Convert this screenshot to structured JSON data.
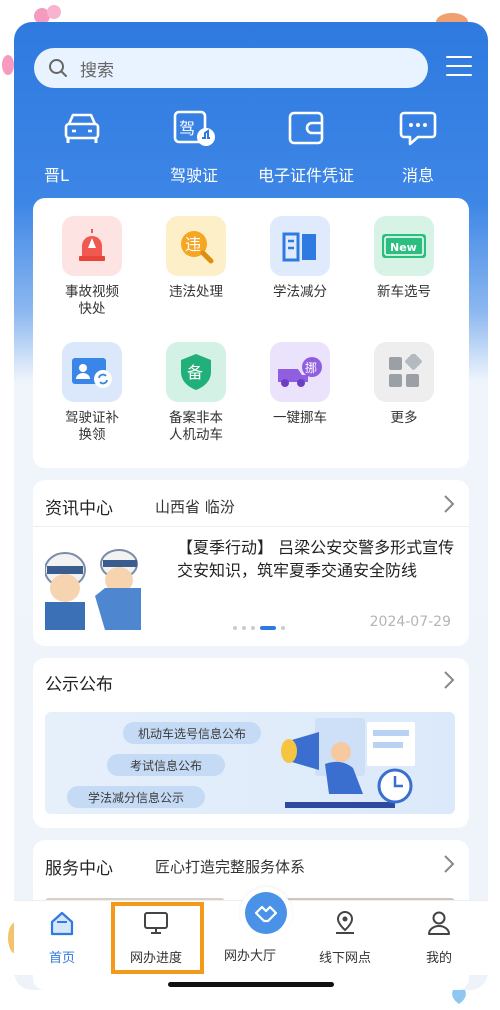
{
  "search": {
    "placeholder": "搜索"
  },
  "shortcuts": [
    {
      "label": "晋L",
      "icon": "car-icon"
    },
    {
      "label": "驾驶证",
      "icon": "license-icon"
    },
    {
      "label": "电子证件凭证",
      "icon": "wallet-icon"
    },
    {
      "label": "消息",
      "icon": "message-icon"
    }
  ],
  "services": [
    {
      "label": "事故视频快处",
      "icon": "alarm-icon",
      "color": "#f0594f"
    },
    {
      "label": "违法处理",
      "icon": "violation-search-icon",
      "color": "#f5a623",
      "glyph": "违"
    },
    {
      "label": "学法减分",
      "icon": "book-icon",
      "color": "#2f7ae0"
    },
    {
      "label": "新车选号",
      "icon": "new-plate-icon",
      "color": "#2bbf7f",
      "glyph": "New"
    },
    {
      "label": "驾驶证补换领",
      "icon": "license-renew-icon",
      "color": "#3a86e8"
    },
    {
      "label": "备案非本人机动车",
      "icon": "filing-shield-icon",
      "color": "#22b07a",
      "glyph": "备"
    },
    {
      "label": "一键挪车",
      "icon": "move-car-icon",
      "color": "#8f5fe0",
      "glyph": "挪"
    },
    {
      "label": "更多",
      "icon": "more-grid-icon",
      "color": "#9aa0a6"
    }
  ],
  "news": {
    "title": "资讯中心",
    "region": "山西省 临汾",
    "headline": "【夏季行动】 吕梁公安交警多形式宣传交安知识，筑牢夏季交通安全防线",
    "date": "2024-07-29"
  },
  "notice": {
    "title": "公示公布",
    "pills": [
      "机动车选号信息公布",
      "考试信息公布",
      "学法减分信息公示"
    ]
  },
  "service_center": {
    "title": "服务中心",
    "subtitle": "匠心打造完整服务体系"
  },
  "tabs": [
    {
      "label": "首页",
      "icon": "home-icon",
      "active": true
    },
    {
      "label": "网办进度",
      "icon": "monitor-icon"
    },
    {
      "label": "网办大厅",
      "icon": "handshake-icon"
    },
    {
      "label": "线下网点",
      "icon": "location-pin-icon"
    },
    {
      "label": "我的",
      "icon": "user-icon"
    }
  ],
  "colors": {
    "brand": "#2f7ae0",
    "highlight": "#f39a1a"
  }
}
